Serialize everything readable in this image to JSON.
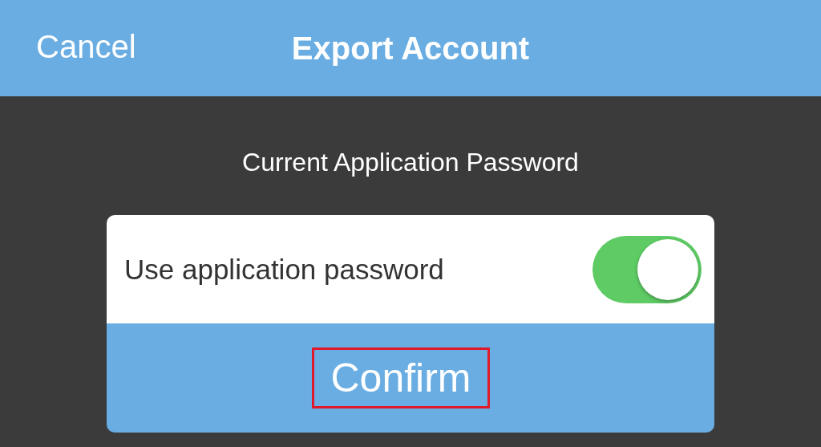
{
  "header": {
    "cancel": "Cancel",
    "title": "Export Account"
  },
  "section_title": "Current Application Password",
  "setting": {
    "label": "Use application password",
    "on": true
  },
  "confirm": {
    "label": "Confirm",
    "highlighted": true
  }
}
